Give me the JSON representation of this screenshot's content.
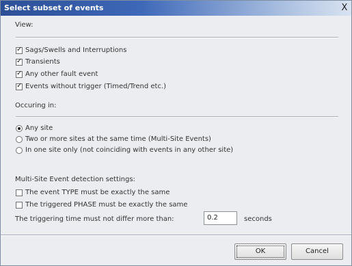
{
  "dialog": {
    "title": "Select subset of events",
    "close_glyph": "X"
  },
  "view": {
    "label": "View:",
    "items": [
      {
        "label": "Sags/Swells and Interruptions",
        "checked": true
      },
      {
        "label": "Transients",
        "checked": true
      },
      {
        "label": "Any other fault event",
        "checked": true
      },
      {
        "label": "Events without trigger (Timed/Trend etc.)",
        "checked": true
      }
    ]
  },
  "occurring": {
    "label": "Occuring in:",
    "options": [
      {
        "label": "Any site",
        "selected": true
      },
      {
        "label": "Two or more sites at the same time (Multi-Site Events)",
        "selected": false
      },
      {
        "label": "In one site only (not coinciding with events in any other site)",
        "selected": false
      }
    ]
  },
  "multisite": {
    "label": "Multi-Site Event detection settings:",
    "items": [
      {
        "label": "The event TYPE must be exactly the same",
        "checked": false
      },
      {
        "label": "The triggered PHASE must be exactly the same",
        "checked": false
      }
    ],
    "time_label": "The triggering time must not differ more than:",
    "time_value": "0.2",
    "time_unit": "seconds"
  },
  "buttons": {
    "ok": "OK",
    "cancel": "Cancel"
  }
}
